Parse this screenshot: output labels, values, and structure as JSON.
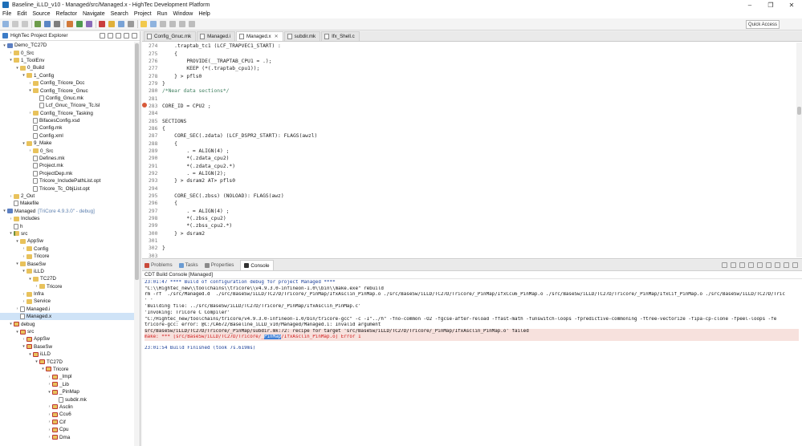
{
  "window": {
    "title": "Baseline_iLLD_v10 - Managed/src/Managed.x - HighTec Development Platform",
    "controls": [
      "–",
      "❐",
      "✕"
    ]
  },
  "menu": [
    "File",
    "Edit",
    "Source",
    "Refactor",
    "Navigate",
    "Search",
    "Project",
    "Run",
    "Window",
    "Help"
  ],
  "toolbar": {
    "quick_access": "Quick Access"
  },
  "explorer": {
    "title": "HighTec Project Explorer",
    "tree": [
      {
        "depth": 0,
        "twisty": "▾",
        "icon": "project",
        "label": "Demo_TC27D"
      },
      {
        "depth": 1,
        "twisty": "›",
        "icon": "folder",
        "label": "0_Src"
      },
      {
        "depth": 1,
        "twisty": "▾",
        "icon": "folder",
        "label": "1_ToolEnv"
      },
      {
        "depth": 2,
        "twisty": "▾",
        "icon": "folder",
        "label": "0_Build"
      },
      {
        "depth": 3,
        "twisty": "▾",
        "icon": "folder",
        "label": "1_Config"
      },
      {
        "depth": 4,
        "twisty": "›",
        "icon": "folder",
        "label": "Config_Tricore_Dcc"
      },
      {
        "depth": 4,
        "twisty": "▾",
        "icon": "folder",
        "label": "Config_Tricore_Gnuc"
      },
      {
        "depth": 5,
        "twisty": "",
        "icon": "file",
        "label": "Config_Gnuc.mk"
      },
      {
        "depth": 5,
        "twisty": "",
        "icon": "file",
        "label": "Lcf_Gnuc_Tricore_Tc.lsl"
      },
      {
        "depth": 4,
        "twisty": "›",
        "icon": "folder",
        "label": "Config_Tricore_Tasking"
      },
      {
        "depth": 4,
        "twisty": "",
        "icon": "file",
        "label": "BifacesConfig.xsd"
      },
      {
        "depth": 4,
        "twisty": "",
        "icon": "file",
        "label": "Config.mk"
      },
      {
        "depth": 4,
        "twisty": "",
        "icon": "file",
        "label": "Config.xml"
      },
      {
        "depth": 3,
        "twisty": "▾",
        "icon": "folder",
        "label": "9_Make"
      },
      {
        "depth": 4,
        "twisty": "›",
        "icon": "folder",
        "label": "0_Src"
      },
      {
        "depth": 4,
        "twisty": "",
        "icon": "file",
        "label": "Defines.mk"
      },
      {
        "depth": 4,
        "twisty": "",
        "icon": "file",
        "label": "Project.mk"
      },
      {
        "depth": 4,
        "twisty": "",
        "icon": "file",
        "label": "ProjectDep.mk"
      },
      {
        "depth": 4,
        "twisty": "",
        "icon": "file",
        "label": "Tricore_IncludePathList.opt"
      },
      {
        "depth": 4,
        "twisty": "",
        "icon": "file",
        "label": "Tricore_Tc_ObjList.opt"
      },
      {
        "depth": 1,
        "twisty": "›",
        "icon": "folder",
        "label": "2_Out"
      },
      {
        "depth": 1,
        "twisty": "",
        "icon": "file",
        "label": "Makefile"
      },
      {
        "depth": 0,
        "twisty": "▾",
        "icon": "project",
        "label": "Managed",
        "suffix": "[TriCore 4.9.3.0\" - debug]"
      },
      {
        "depth": 1,
        "twisty": "›",
        "icon": "folder",
        "label": "Includes"
      },
      {
        "depth": 1,
        "twisty": "",
        "icon": "file",
        "label": "h"
      },
      {
        "depth": 1,
        "twisty": "▾",
        "icon": "folder-src",
        "label": "src"
      },
      {
        "depth": 2,
        "twisty": "▾",
        "icon": "folder",
        "label": "AppSw"
      },
      {
        "depth": 3,
        "twisty": "›",
        "icon": "folder",
        "label": "Config"
      },
      {
        "depth": 3,
        "twisty": "›",
        "icon": "folder",
        "label": "Tricore"
      },
      {
        "depth": 2,
        "twisty": "▾",
        "icon": "folder",
        "label": "BaseSw"
      },
      {
        "depth": 3,
        "twisty": "▾",
        "icon": "folder",
        "label": "iLLD"
      },
      {
        "depth": 4,
        "twisty": "▾",
        "icon": "folder",
        "label": "TC27D"
      },
      {
        "depth": 5,
        "twisty": "›",
        "icon": "folder",
        "label": "Tricore"
      },
      {
        "depth": 3,
        "twisty": "›",
        "icon": "folder",
        "label": "Infra"
      },
      {
        "depth": 3,
        "twisty": "›",
        "icon": "folder",
        "label": "Service"
      },
      {
        "depth": 2,
        "twisty": "›",
        "icon": "file",
        "label": "Managed.i"
      },
      {
        "depth": 2,
        "twisty": "",
        "icon": "file",
        "label": "Managed.x",
        "selected": true
      },
      {
        "depth": 1,
        "twisty": "▾",
        "icon": "excl",
        "label": "debug"
      },
      {
        "depth": 2,
        "twisty": "▾",
        "icon": "excl",
        "label": "src"
      },
      {
        "depth": 3,
        "twisty": "›",
        "icon": "excl",
        "label": "AppSw"
      },
      {
        "depth": 3,
        "twisty": "▾",
        "icon": "excl",
        "label": "BaseSw"
      },
      {
        "depth": 4,
        "twisty": "▾",
        "icon": "excl",
        "label": "iLLD"
      },
      {
        "depth": 5,
        "twisty": "▾",
        "icon": "excl",
        "label": "TC27D"
      },
      {
        "depth": 6,
        "twisty": "▾",
        "icon": "excl",
        "label": "Tricore"
      },
      {
        "depth": 7,
        "twisty": "›",
        "icon": "excl",
        "label": "_Impl"
      },
      {
        "depth": 7,
        "twisty": "›",
        "icon": "excl",
        "label": "_Lib"
      },
      {
        "depth": 7,
        "twisty": "▾",
        "icon": "excl",
        "label": "_PinMap"
      },
      {
        "depth": 8,
        "twisty": "",
        "icon": "file",
        "label": "subdir.mk"
      },
      {
        "depth": 7,
        "twisty": "›",
        "icon": "excl",
        "label": "Asclin"
      },
      {
        "depth": 7,
        "twisty": "›",
        "icon": "excl",
        "label": "Ccu6"
      },
      {
        "depth": 7,
        "twisty": "›",
        "icon": "excl",
        "label": "Cif"
      },
      {
        "depth": 7,
        "twisty": "›",
        "icon": "excl",
        "label": "Cpu"
      },
      {
        "depth": 7,
        "twisty": "›",
        "icon": "excl",
        "label": "Dma"
      }
    ]
  },
  "editor": {
    "tabs": [
      {
        "label": "Config_Gnuc.mk",
        "active": false
      },
      {
        "label": "Managed.i",
        "active": false
      },
      {
        "label": "Managed.x",
        "active": true
      },
      {
        "label": "subdir.mk",
        "active": false
      },
      {
        "label": "Ifx_Shell.c",
        "active": false
      }
    ],
    "lines": [
      {
        "n": "274",
        "text": "    .traptab_tc1 (LCF_TRAPVEC1_START) :",
        "type": "code"
      },
      {
        "n": "275",
        "text": "    {",
        "type": "code"
      },
      {
        "n": "276",
        "text": "        PROVIDE(__TRAPTAB_CPU1 = .);",
        "type": "code"
      },
      {
        "n": "277",
        "text": "        KEEP (*(.traptab_cpu1));",
        "type": "code"
      },
      {
        "n": "278",
        "text": "    } > pfls0",
        "type": "code"
      },
      {
        "n": "279",
        "text": "}",
        "type": "code"
      },
      {
        "n": "280",
        "text": "/*Near data sections*/",
        "type": "comment"
      },
      {
        "n": "281",
        "text": "",
        "type": "code"
      },
      {
        "n": "283",
        "text": "CORE_ID = CPU2 ;",
        "type": "code",
        "marker": true,
        "underline": "CPU2"
      },
      {
        "n": "284",
        "text": "",
        "type": "code"
      },
      {
        "n": "285",
        "text": "SECTIONS",
        "type": "code"
      },
      {
        "n": "286",
        "text": "{",
        "type": "code"
      },
      {
        "n": "287",
        "text": "    CORE_SEC(.zdata) (LCF_DSPR2_START): FLAGS(awzl)",
        "type": "code"
      },
      {
        "n": "288",
        "text": "    {",
        "type": "code"
      },
      {
        "n": "289",
        "text": "        . = ALIGN(4) ;",
        "type": "code"
      },
      {
        "n": "290",
        "text": "        *(.zdata_cpu2)",
        "type": "code"
      },
      {
        "n": "291",
        "text": "        *(.zdata_cpu2.*)",
        "type": "code"
      },
      {
        "n": "292",
        "text": "        . = ALIGN(2);",
        "type": "code"
      },
      {
        "n": "293",
        "text": "    } > dsram2 AT> pfls0",
        "type": "code"
      },
      {
        "n": "294",
        "text": "",
        "type": "code"
      },
      {
        "n": "295",
        "text": "    CORE_SEC(.zbss) (NOLOAD): FLAGS(awz)",
        "type": "code"
      },
      {
        "n": "296",
        "text": "    {",
        "type": "code"
      },
      {
        "n": "297",
        "text": "        . = ALIGN(4) ;",
        "type": "code"
      },
      {
        "n": "298",
        "text": "        *(.zbss_cpu2)",
        "type": "code"
      },
      {
        "n": "299",
        "text": "        *(.zbss_cpu2.*)",
        "type": "code"
      },
      {
        "n": "300",
        "text": "    } > dsram2",
        "type": "code"
      },
      {
        "n": "301",
        "text": "",
        "type": "code"
      },
      {
        "n": "302",
        "text": "}",
        "type": "code"
      },
      {
        "n": "303",
        "text": "",
        "type": "code"
      },
      {
        "n": "304",
        "text": "CORE_ID = CPU1;",
        "type": "code",
        "marker": true,
        "underline": "CPU1"
      },
      {
        "n": "305",
        "text": "",
        "type": "code"
      },
      {
        "n": "306",
        "text": "SECTIONS",
        "type": "code"
      }
    ]
  },
  "console": {
    "tabs": [
      {
        "label": "Problems",
        "active": false,
        "color": "#c94a3a"
      },
      {
        "label": "Tasks",
        "active": false,
        "color": "#6a9bd2"
      },
      {
        "label": "Properties",
        "active": false,
        "color": "#8a8a8a"
      },
      {
        "label": "Console",
        "active": true,
        "color": "#333333"
      }
    ],
    "title": "CDT Build Console [Managed]",
    "lines": [
      {
        "text": "23:01:47 **** Build of configuration debug for project Managed ****",
        "style": "blue"
      },
      {
        "text": "\"C:\\\\Hightec_new\\\\toolchains\\\\tricore\\\\v4.9.3.0-infineon-1.0\\\\bin\\\\make.exe\" rebuild",
        "style": ""
      },
      {
        "text": "rm -rf  ./src/Managed.d  ./src/BaseSw/iLLD/TC27D/Tricore/_PinMap/IfxAsclin_PinMap.o ./src/BaseSw/iLLD/TC27D/Tricore/_PinMap/IfxCcu6_PinMap.o ./src/BaseSw/iLLD/TC27D/Tricore/_PinMap/IfxCif_PinMap.o ./src/BaseSw/iLLD/TC27D/Tric",
        "style": ""
      },
      {
        "text": "' '",
        "style": ""
      },
      {
        "text": "'Building file: ../src/BaseSw/iLLD/TC27D/Tricore/_PinMap/IfxAsclin_PinMap.c'",
        "style": ""
      },
      {
        "text": "'Invoking: TriCore C Compiler'",
        "style": ""
      },
      {
        "text": "\"C:/Hightec_new/toolchains/tricore/v4.9.3.0-infineon-1.0/bin/tricore-gcc\" -c -I\"../h\" -fno-common -O2 -fgcse-after-reload -ffast-math -funswitch-loops -fpredictive-commoning -ftree-vectorize -fipa-cp-clone -fpeel-loops -fe",
        "style": ""
      },
      {
        "text": "tricore-gcc: error: @C:/CA672/Baseline_iLLD_v10/Managed/Managed.i: Invalid argument",
        "style": ""
      },
      {
        "text": "src/BaseSw/iLLD/TC27D/Tricore/_PinMap/subdir.mk:72: recipe for target 'src/BaseSw/iLLD/TC27D/Tricore/_PinMap/IfxAsclin_PinMap.o' failed",
        "style": "err-bg"
      },
      {
        "pre": "make: *** [src/BaseSw/iLLD/TC27D/Tricore/_",
        "sel": "PinMap",
        "post": "/IfxAsclin_PinMap.o] Error 1",
        "style": "red"
      },
      {
        "text": "",
        "style": "gap"
      },
      {
        "text": "23:01:54 Build Finished (took 7s.619ms)",
        "style": "blue"
      }
    ]
  }
}
